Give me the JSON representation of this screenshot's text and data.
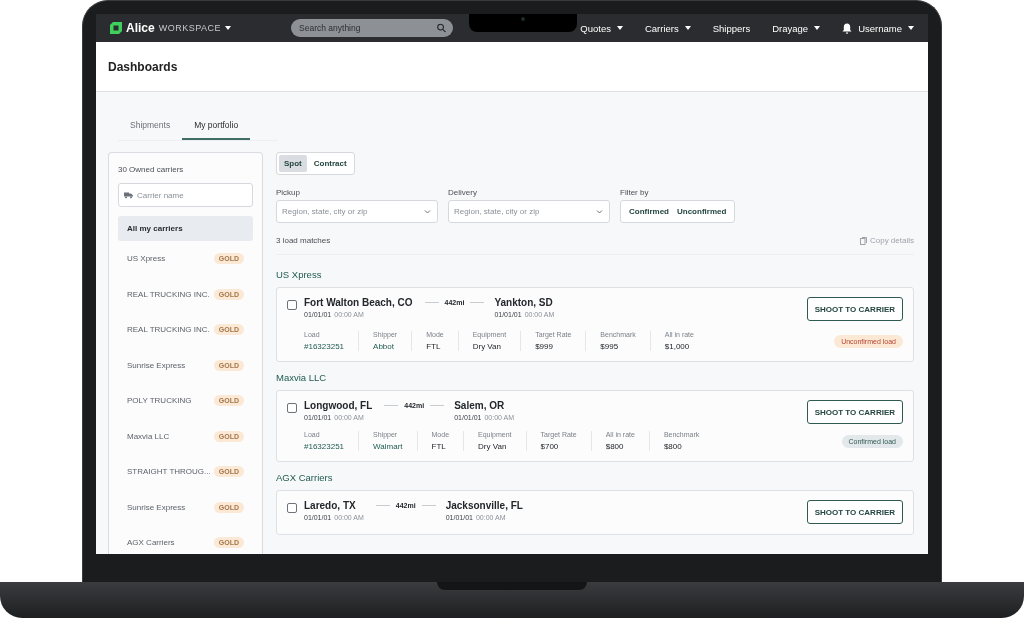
{
  "brand": {
    "name": "Alice",
    "suffix": "WORKSPACE"
  },
  "search": {
    "placeholder": "Search anything"
  },
  "nav": [
    {
      "label": "Quotes",
      "has_menu": true
    },
    {
      "label": "Carriers",
      "has_menu": true
    },
    {
      "label": "Shippers",
      "has_menu": false
    },
    {
      "label": "Drayage",
      "has_menu": true
    }
  ],
  "user": {
    "label": "Username"
  },
  "page_title": "Dashboards",
  "tabs": [
    {
      "label": "Shipments",
      "selected": false
    },
    {
      "label": "My portfolio",
      "selected": true
    }
  ],
  "sidebar": {
    "count": "30 Owned carriers",
    "search_placeholder": "Carrier name",
    "items": [
      {
        "label": "All my carriers",
        "selected": true
      },
      {
        "label": "US Xpress",
        "badge": "GOLD",
        "selected": false
      },
      {
        "label": "REAL TRUCKING INC.",
        "badge": "GOLD",
        "selected": false
      },
      {
        "label": "REAL TRUCKING INC.",
        "badge": "GOLD",
        "selected": false
      },
      {
        "label": "Sunrise Express",
        "badge": "GOLD",
        "selected": false
      },
      {
        "label": "POLY TRUCKING",
        "badge": "GOLD",
        "selected": false
      },
      {
        "label": "Maxvia LLC",
        "badge": "GOLD",
        "selected": false
      },
      {
        "label": "STRAIGHT THROUG...",
        "badge": "GOLD",
        "selected": false
      },
      {
        "label": "Sunrise Express",
        "badge": "GOLD",
        "selected": false
      },
      {
        "label": "AGX Carriers",
        "badge": "GOLD",
        "selected": false
      }
    ]
  },
  "mode_toggle": [
    {
      "label": "Spot",
      "selected": true
    },
    {
      "label": "Contract",
      "selected": false
    }
  ],
  "filters": [
    {
      "label": "Pickup",
      "placeholder": "Region, state, city or zip"
    },
    {
      "label": "Delivery",
      "placeholder": "Region, state, city or zip"
    }
  ],
  "filter_by": {
    "label": "Filter by",
    "options": [
      {
        "label": "Confirmed",
        "selected": false
      },
      {
        "label": "Unconfirmed",
        "selected": false
      }
    ]
  },
  "matches": "3 load matches",
  "copy_details": {
    "label": "Copy details",
    "disabled": true
  },
  "groups": [
    {
      "carrier": "US Xpress",
      "load": {
        "checked": false,
        "origin": "Fort Walton Beach, CO",
        "origin_date": "01/01/01",
        "origin_time": "00:00 AM",
        "distance": "442mi",
        "destination": "Yankton, SD",
        "destination_date": "01/01/01",
        "destination_time": "00:00 AM",
        "action": "SHOOT TO CARRIER",
        "kind": "unconfirmed",
        "status_label": "Unconfirmed load",
        "fields": [
          {
            "label": "Load",
            "value": "#16323251",
            "link": true
          },
          {
            "label": "Shipper",
            "value": "Abbot",
            "link": true
          },
          {
            "label": "Mode",
            "value": "FTL",
            "link": false
          },
          {
            "label": "Equipment",
            "value": "Dry Van",
            "link": false
          },
          {
            "label": "Target Rate",
            "value": "$999",
            "link": false
          },
          {
            "label": "Benchmark",
            "value": "$995",
            "link": false
          },
          {
            "label": "All in rate",
            "value": "$1,000",
            "link": false
          }
        ]
      }
    },
    {
      "carrier": "Maxvia LLC",
      "load": {
        "checked": false,
        "origin": "Longwood, FL",
        "origin_date": "01/01/01",
        "origin_time": "00:00 AM",
        "distance": "442mi",
        "destination": "Salem, OR",
        "destination_date": "01/01/01",
        "destination_time": "00:00 AM",
        "action": "SHOOT TO CARRIER",
        "kind": "confirmed",
        "status_label": "Confirmed load",
        "fields": [
          {
            "label": "Load",
            "value": "#16323251",
            "link": true
          },
          {
            "label": "Shipper",
            "value": "Walmart",
            "link": true
          },
          {
            "label": "Mode",
            "value": "FTL",
            "link": false
          },
          {
            "label": "Equipment",
            "value": "Dry Van",
            "link": false
          },
          {
            "label": "Target Rate",
            "value": "$700",
            "link": false
          },
          {
            "label": "All in rate",
            "value": "$800",
            "link": false
          },
          {
            "label": "Benchmark",
            "value": "$800",
            "link": false
          }
        ]
      }
    },
    {
      "carrier": "AGX Carriers",
      "load": {
        "checked": false,
        "origin": "Laredo, TX",
        "origin_date": "01/01/01",
        "origin_time": "00:00 AM",
        "distance": "442mi",
        "destination": "Jacksonville, FL",
        "destination_date": "01/01/01",
        "destination_time": "00:00 AM",
        "action": "SHOOT TO CARRIER"
      }
    }
  ]
}
